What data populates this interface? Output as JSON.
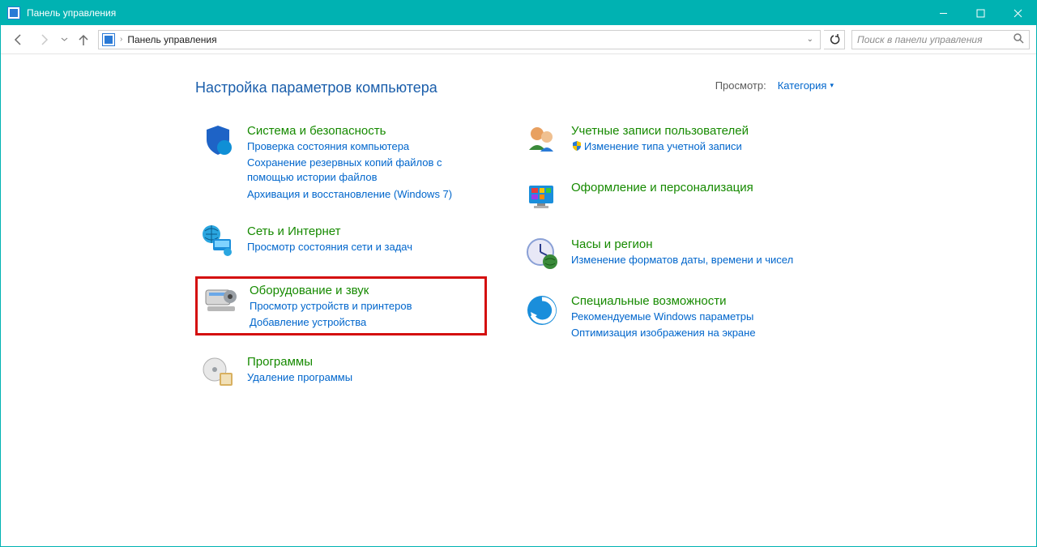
{
  "window": {
    "title": "Панель управления"
  },
  "address": {
    "location": "Панель управления"
  },
  "search": {
    "placeholder": "Поиск в панели управления"
  },
  "header": {
    "heading": "Настройка параметров компьютера",
    "view_label": "Просмотр:",
    "view_value": "Категория"
  },
  "left_categories": [
    {
      "icon": "shield-icon",
      "title": "Система и безопасность",
      "links": [
        "Проверка состояния компьютера",
        "Сохранение резервных копий файлов с помощью истории файлов",
        "Архивация и восстановление (Windows 7)"
      ]
    },
    {
      "icon": "network-icon",
      "title": "Сеть и Интернет",
      "links": [
        "Просмотр состояния сети и задач"
      ]
    },
    {
      "icon": "hardware-icon",
      "title": "Оборудование и звук",
      "links": [
        "Просмотр устройств и принтеров",
        "Добавление устройства"
      ],
      "highlight": true
    },
    {
      "icon": "programs-icon",
      "title": "Программы",
      "links": [
        "Удаление программы"
      ]
    }
  ],
  "right_categories": [
    {
      "icon": "users-icon",
      "title": "Учетные записи пользователей",
      "links": [
        "Изменение типа учетной записи"
      ],
      "shield_on_first_link": true
    },
    {
      "icon": "personalize-icon",
      "title": "Оформление и персонализация",
      "links": []
    },
    {
      "icon": "clock-icon",
      "title": "Часы и регион",
      "links": [
        "Изменение форматов даты, времени и чисел"
      ]
    },
    {
      "icon": "ease-icon",
      "title": "Специальные возможности",
      "links": [
        "Рекомендуемые Windows параметры",
        "Оптимизация изображения на экране"
      ]
    }
  ]
}
